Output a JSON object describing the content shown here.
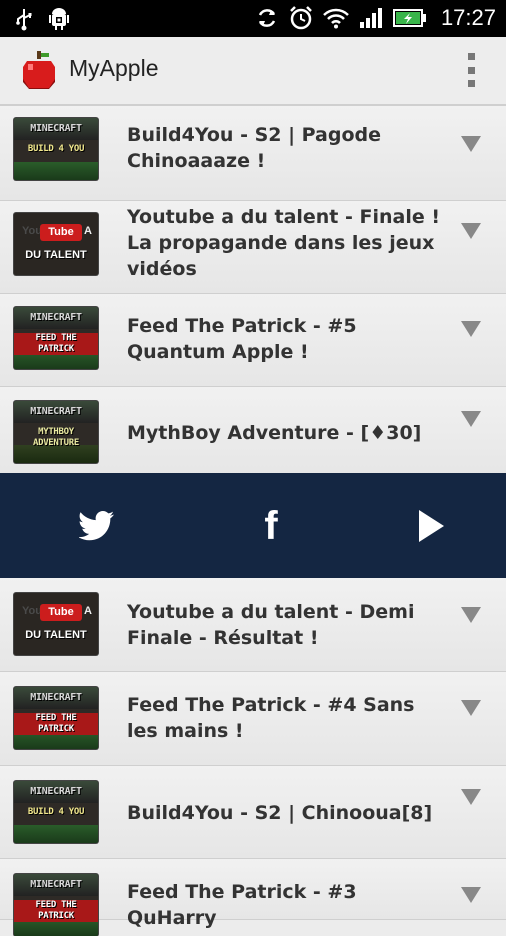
{
  "statusbar": {
    "time": "17:27",
    "left_icons": [
      "usb-icon",
      "android-debug-icon"
    ],
    "right_icons": [
      "sync-icon",
      "alarm-icon",
      "wifi-icon",
      "signal-icon",
      "battery-charging-icon"
    ]
  },
  "actionbar": {
    "title": "MyApple",
    "app_icon": "apple-icon",
    "overflow_icon": "overflow-menu-icon"
  },
  "videos_top": [
    {
      "title": "Build4You - S2 | Pagode Chinoaaaze !",
      "thumb": {
        "style": "mc",
        "line1": "MINECRAFT",
        "line2": "BUILD 4 YOU",
        "line3": ""
      }
    },
    {
      "title": "Youtube a du talent - Finale ! La propagande dans les jeux vidéos",
      "thumb": {
        "style": "yt",
        "line1": "You",
        "line2": "Tube",
        "line3": "A",
        "line4": "DU TALENT"
      }
    },
    {
      "title": "Feed The Patrick - #5 Quantum Apple !",
      "thumb": {
        "style": "red",
        "line1": "MINECRAFT",
        "line2": "FEED THE",
        "line3": "PATRICK"
      }
    },
    {
      "title": "MythBoy Adventure - [♦30]",
      "thumb": {
        "style": "mc",
        "line1": "MINECRAFT",
        "line2": "MYTHBOY",
        "line3": "ADVENTURE"
      }
    }
  ],
  "social": {
    "items": [
      {
        "icon": "twitter-icon"
      },
      {
        "icon": "facebook-icon",
        "glyph": "f"
      },
      {
        "icon": "play-icon"
      }
    ],
    "background": "#142642"
  },
  "videos_bottom": [
    {
      "title": "Youtube a du talent - Demi Finale - Résultat !",
      "thumb": {
        "style": "yt",
        "line1": "You",
        "line2": "Tube",
        "line3": "A",
        "line4": "DU TALENT"
      }
    },
    {
      "title": "Feed The Patrick - #4 Sans les mains !",
      "thumb": {
        "style": "red",
        "line1": "MINECRAFT",
        "line2": "FEED THE",
        "line3": "PATRICK"
      }
    },
    {
      "title": "Build4You - S2 | Chinooua[8]",
      "thumb": {
        "style": "mc",
        "line1": "MINECRAFT",
        "line2": "BUILD 4 YOU",
        "line3": ""
      }
    },
    {
      "title": "Feed The Patrick - #3 QuHarry",
      "thumb": {
        "style": "red",
        "line1": "MINECRAFT",
        "line2": "FEED THE",
        "line3": "PATRICK"
      }
    }
  ],
  "colors": {
    "accent": "#142642",
    "chevron": "#888888",
    "apple": "#d81c1c"
  }
}
